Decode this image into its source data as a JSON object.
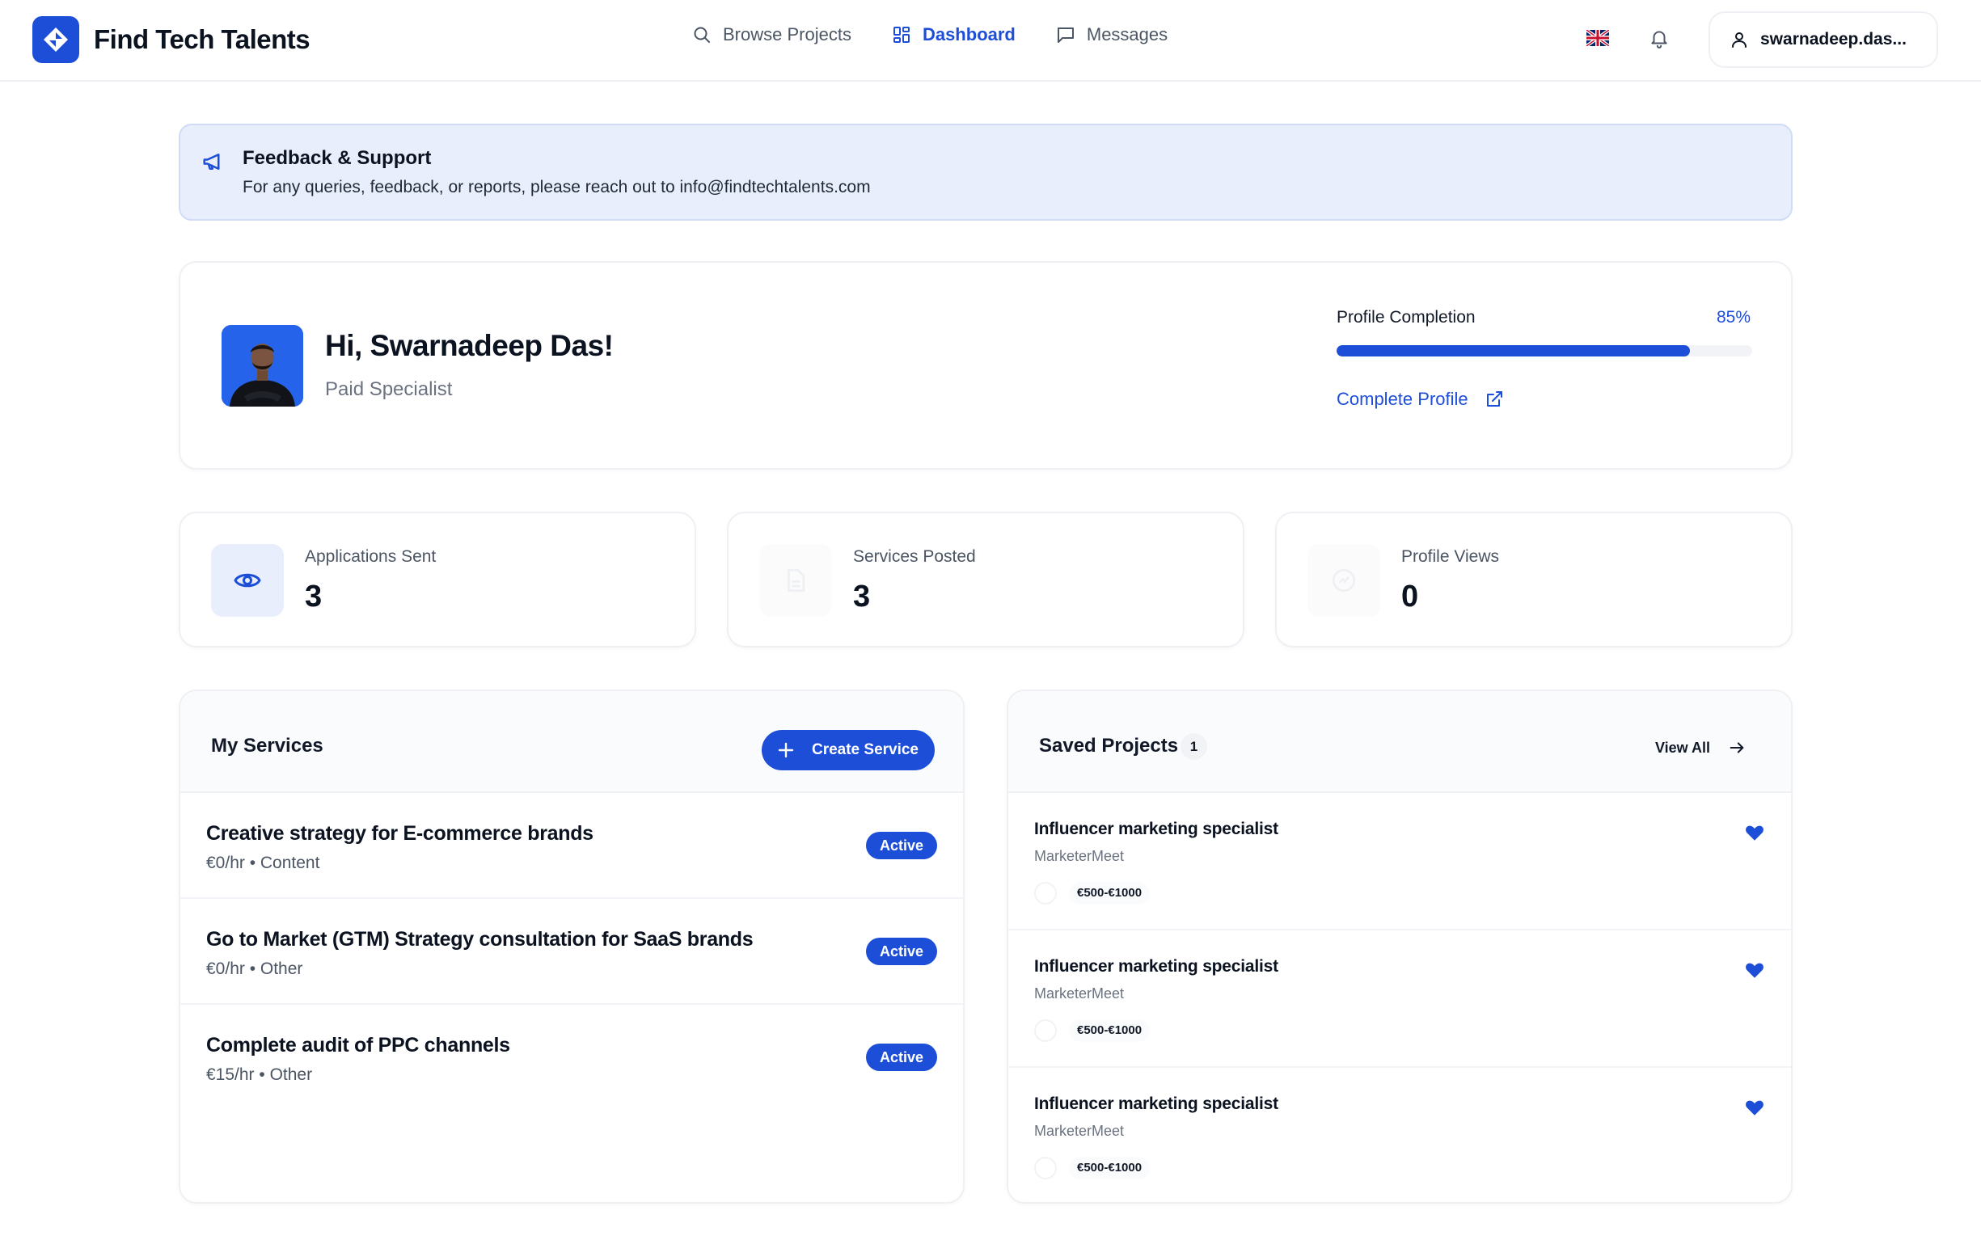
{
  "header": {
    "brand_name": "Find Tech Talents",
    "nav": [
      {
        "label": "Browse Projects",
        "icon": "search-icon",
        "active": false
      },
      {
        "label": "Dashboard",
        "icon": "dashboard-grid-icon",
        "active": true
      },
      {
        "label": "Messages",
        "icon": "message-icon",
        "active": false
      }
    ],
    "language_icon": "uk-flag-icon",
    "user_label": "swarnadeep.das..."
  },
  "banner": {
    "title": "Feedback & Support",
    "text": "For any queries, feedback, or reports, please reach out to info@findtechtalents.com"
  },
  "welcome": {
    "greeting": "Hi, Swarnadeep Das!",
    "role": "Paid Specialist",
    "profile_completion_label": "Profile Completion",
    "profile_completion_value": "85%",
    "profile_completion_fraction": 0.85,
    "complete_profile_link": "Complete Profile"
  },
  "stats": [
    {
      "label": "Applications Sent",
      "value": "3",
      "icon": "eye-icon"
    },
    {
      "label": "Services Posted",
      "value": "3",
      "icon": "document-icon"
    },
    {
      "label": "Profile Views",
      "value": "0",
      "icon": "chart-icon"
    }
  ],
  "my_services": {
    "title": "My Services",
    "create_label": "Create Service",
    "items": [
      {
        "title": "Creative strategy for E-commerce brands",
        "meta": "€0/hr • Content",
        "status": "Active"
      },
      {
        "title": "Go to Market (GTM) Strategy consultation for SaaS brands",
        "meta": "€0/hr • Other",
        "status": "Active"
      },
      {
        "title": "Complete audit of PPC channels",
        "meta": "€15/hr • Other",
        "status": "Active"
      }
    ]
  },
  "saved_projects": {
    "title": "Saved Projects",
    "count": "1",
    "view_all_label": "View All",
    "items": [
      {
        "title": "Influencer marketing specialist",
        "company": "MarketerMeet",
        "budget": "€500-€1000"
      },
      {
        "title": "Influencer marketing specialist",
        "company": "MarketerMeet",
        "budget": "€500-€1000"
      },
      {
        "title": "Influencer marketing specialist",
        "company": "MarketerMeet",
        "budget": "€500-€1000"
      }
    ]
  },
  "colors": {
    "accent": "#1d4ed8",
    "banner_bg": "#e8eefc",
    "card_border": "#eef0f4"
  }
}
